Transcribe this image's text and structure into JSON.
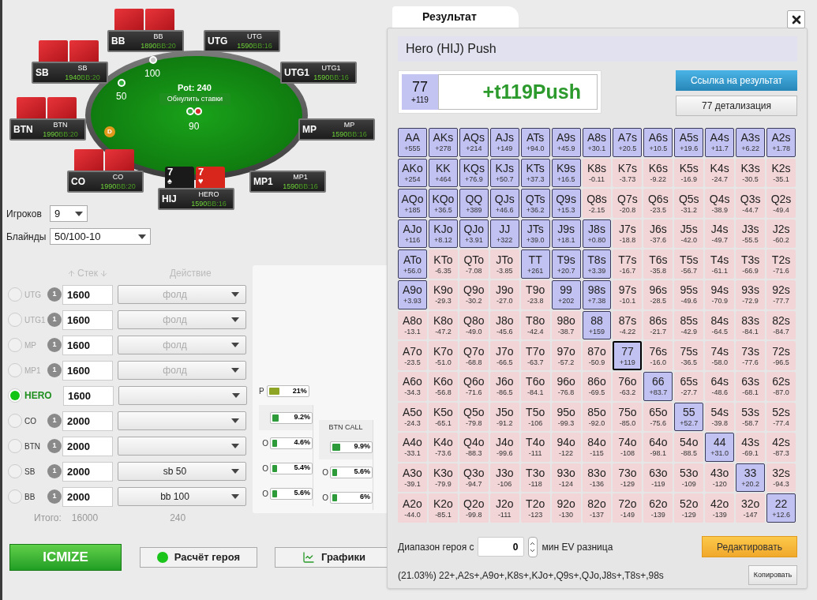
{
  "table": {
    "seats": [
      {
        "position": "BB",
        "name": "BB",
        "stack": "1890",
        "bb": "BB:20",
        "kind": "backs"
      },
      {
        "position": "UTG",
        "name": "UTG",
        "stack": "1590",
        "bb": "BB:16",
        "kind": "empty"
      },
      {
        "position": "SB",
        "name": "SB",
        "stack": "1940",
        "bb": "BB:20",
        "kind": "backs"
      },
      {
        "position": "UTG1",
        "name": "UTG1",
        "stack": "1590",
        "bb": "BB:16",
        "kind": "empty"
      },
      {
        "position": "BTN",
        "name": "BTN",
        "stack": "1990",
        "bb": "BB:20",
        "kind": "backs"
      },
      {
        "position": "MP",
        "name": "MP",
        "stack": "1590",
        "bb": "BB:16",
        "kind": "empty"
      },
      {
        "position": "CO",
        "name": "CO",
        "stack": "1990",
        "bb": "BB:20",
        "kind": "backs"
      },
      {
        "position": "HIJ",
        "name": "HERO",
        "stack": "1590",
        "bb": "BB:16",
        "kind": "open",
        "cards": [
          {
            "rank": "7",
            "suit": "♠",
            "red": false
          },
          {
            "rank": "7",
            "suit": "♥",
            "red": true
          }
        ]
      },
      {
        "position": "MP1",
        "name": "MP1",
        "stack": "1590",
        "bb": "BB:16",
        "kind": "empty"
      }
    ],
    "pot": "Pot: 240",
    "reset_button": "Обнулить ставки",
    "bets": [
      {
        "amount": "100",
        "chips": [
          {
            "color": "#c8c8c8"
          }
        ]
      },
      {
        "amount": "50",
        "chips": [
          {
            "color": "#2fae3a"
          }
        ]
      },
      {
        "amount": "90",
        "chips": [
          {
            "color": "#2fae3a"
          },
          {
            "color": "#d42a2a"
          }
        ]
      }
    ],
    "dealer": "D"
  },
  "controls": [
    {
      "label": "Игроков",
      "value": "9"
    },
    {
      "label": "Блайнды",
      "value": "50/100-10"
    }
  ],
  "players": {
    "stack_header": "Стек",
    "action_header": "Действие",
    "rows": [
      {
        "position": "UTG",
        "chips": "1",
        "stack": "1600",
        "action": "фолд",
        "folded": true,
        "selected": false
      },
      {
        "position": "UTG1",
        "chips": "1",
        "stack": "1600",
        "action": "фолд",
        "folded": true,
        "selected": false
      },
      {
        "position": "MP",
        "chips": "1",
        "stack": "1600",
        "action": "фолд",
        "folded": true,
        "selected": false
      },
      {
        "position": "MP1",
        "chips": "1",
        "stack": "1600",
        "action": "фолд",
        "folded": true,
        "selected": false
      },
      {
        "position": "HERO",
        "stack": "1600",
        "folded": false,
        "selected": true
      },
      {
        "position": "CO",
        "chips": "1",
        "stack": "2000",
        "folded": false,
        "selected": false
      },
      {
        "position": "BTN",
        "chips": "1",
        "stack": "2000",
        "folded": false,
        "selected": false
      },
      {
        "position": "SB",
        "chips": "1",
        "stack": "2000",
        "action": "sb 50",
        "folded": false,
        "selected": false
      },
      {
        "position": "BB",
        "chips": "1",
        "stack": "2000",
        "action": "bb 100",
        "folded": false,
        "selected": false
      }
    ],
    "total_label": "Итого:",
    "total_stack": "16000",
    "total_pot": "240"
  },
  "range_panel": {
    "push": {
      "label": "P",
      "level": 0.26,
      "value": "21%"
    },
    "columns": [
      {
        "rows": [
          {
            "level": 0.16,
            "value": "9.2%"
          },
          {
            "prefix": "O",
            "level": 0.12,
            "value": "4.6%"
          },
          {
            "prefix": "O",
            "level": 0.12,
            "value": "5.4%"
          },
          {
            "prefix": "O",
            "level": 0.12,
            "value": "5.6%"
          }
        ]
      },
      {
        "title": "BTN CALL",
        "rows": [
          {
            "level": 0.2,
            "value": "9.9%"
          },
          {
            "prefix": "O",
            "level": 0.12,
            "value": "5.6%"
          },
          {
            "prefix": "O",
            "level": 0.12,
            "value": "6%"
          }
        ]
      }
    ]
  },
  "buttons": [
    {
      "kind": "icmize",
      "label": "ICMIZE"
    },
    {
      "kind": "hero",
      "label": "Расчёт героя"
    },
    {
      "kind": "charts",
      "label": "Графики"
    }
  ],
  "result": {
    "tab": "Результат",
    "title": "Hero (HIJ) Push",
    "hand": "77",
    "hand_ev": "+119",
    "value": "+t119Push",
    "link_button": "Ссылка на результат",
    "detail_button": "77 детализация",
    "grid": [
      [
        {
          "hand": "AA",
          "ev": "+555",
          "in_range": true,
          "selected": false
        },
        {
          "hand": "AKs",
          "ev": "+278",
          "in_range": true,
          "selected": false
        },
        {
          "hand": "AQs",
          "ev": "+214",
          "in_range": true,
          "selected": false
        },
        {
          "hand": "AJs",
          "ev": "+149",
          "in_range": true,
          "selected": false
        },
        {
          "hand": "ATs",
          "ev": "+94.0",
          "in_range": true,
          "selected": false
        },
        {
          "hand": "A9s",
          "ev": "+45.9",
          "in_range": true,
          "selected": false
        },
        {
          "hand": "A8s",
          "ev": "+30.1",
          "in_range": true,
          "selected": false
        },
        {
          "hand": "A7s",
          "ev": "+20.5",
          "in_range": true,
          "selected": false
        },
        {
          "hand": "A6s",
          "ev": "+10.5",
          "in_range": true,
          "selected": false
        },
        {
          "hand": "A5s",
          "ev": "+19.6",
          "in_range": true,
          "selected": false
        },
        {
          "hand": "A4s",
          "ev": "+11.7",
          "in_range": true,
          "selected": false
        },
        {
          "hand": "A3s",
          "ev": "+6.22",
          "in_range": true,
          "selected": false
        },
        {
          "hand": "A2s",
          "ev": "+1.78",
          "in_range": true,
          "selected": false
        }
      ],
      [
        {
          "hand": "AKo",
          "ev": "+254",
          "in_range": true,
          "selected": false
        },
        {
          "hand": "KK",
          "ev": "+464",
          "in_range": true,
          "selected": false
        },
        {
          "hand": "KQs",
          "ev": "+76.9",
          "in_range": true,
          "selected": false
        },
        {
          "hand": "KJs",
          "ev": "+50.7",
          "in_range": true,
          "selected": false
        },
        {
          "hand": "KTs",
          "ev": "+37.3",
          "in_range": true,
          "selected": false
        },
        {
          "hand": "K9s",
          "ev": "+16.5",
          "in_range": true,
          "selected": false
        },
        {
          "hand": "K8s",
          "ev": "-0.11",
          "in_range": false,
          "selected": false
        },
        {
          "hand": "K7s",
          "ev": "-3.73",
          "in_range": false,
          "selected": false
        },
        {
          "hand": "K6s",
          "ev": "-9.22",
          "in_range": false,
          "selected": false
        },
        {
          "hand": "K5s",
          "ev": "-16.9",
          "in_range": false,
          "selected": false
        },
        {
          "hand": "K4s",
          "ev": "-24.7",
          "in_range": false,
          "selected": false
        },
        {
          "hand": "K3s",
          "ev": "-30.5",
          "in_range": false,
          "selected": false
        },
        {
          "hand": "K2s",
          "ev": "-35.1",
          "in_range": false,
          "selected": false
        }
      ],
      [
        {
          "hand": "AQo",
          "ev": "+185",
          "in_range": true,
          "selected": false
        },
        {
          "hand": "KQo",
          "ev": "+36.5",
          "in_range": true,
          "selected": false
        },
        {
          "hand": "QQ",
          "ev": "+389",
          "in_range": true,
          "selected": false
        },
        {
          "hand": "QJs",
          "ev": "+46.6",
          "in_range": true,
          "selected": false
        },
        {
          "hand": "QTs",
          "ev": "+36.2",
          "in_range": true,
          "selected": false
        },
        {
          "hand": "Q9s",
          "ev": "+15.3",
          "in_range": true,
          "selected": false
        },
        {
          "hand": "Q8s",
          "ev": "-2.15",
          "in_range": false,
          "selected": false
        },
        {
          "hand": "Q7s",
          "ev": "-20.8",
          "in_range": false,
          "selected": false
        },
        {
          "hand": "Q6s",
          "ev": "-23.5",
          "in_range": false,
          "selected": false
        },
        {
          "hand": "Q5s",
          "ev": "-31.2",
          "in_range": false,
          "selected": false
        },
        {
          "hand": "Q4s",
          "ev": "-38.9",
          "in_range": false,
          "selected": false
        },
        {
          "hand": "Q3s",
          "ev": "-44.7",
          "in_range": false,
          "selected": false
        },
        {
          "hand": "Q2s",
          "ev": "-49.4",
          "in_range": false,
          "selected": false
        }
      ],
      [
        {
          "hand": "AJo",
          "ev": "+116",
          "in_range": true,
          "selected": false
        },
        {
          "hand": "KJo",
          "ev": "+8.12",
          "in_range": true,
          "selected": false
        },
        {
          "hand": "QJo",
          "ev": "+3.91",
          "in_range": true,
          "selected": false
        },
        {
          "hand": "JJ",
          "ev": "+322",
          "in_range": true,
          "selected": false
        },
        {
          "hand": "JTs",
          "ev": "+39.0",
          "in_range": true,
          "selected": false
        },
        {
          "hand": "J9s",
          "ev": "+18.1",
          "in_range": true,
          "selected": false
        },
        {
          "hand": "J8s",
          "ev": "+0.80",
          "in_range": true,
          "selected": false
        },
        {
          "hand": "J7s",
          "ev": "-18.8",
          "in_range": false,
          "selected": false
        },
        {
          "hand": "J6s",
          "ev": "-37.6",
          "in_range": false,
          "selected": false
        },
        {
          "hand": "J5s",
          "ev": "-42.0",
          "in_range": false,
          "selected": false
        },
        {
          "hand": "J4s",
          "ev": "-49.7",
          "in_range": false,
          "selected": false
        },
        {
          "hand": "J3s",
          "ev": "-55.5",
          "in_range": false,
          "selected": false
        },
        {
          "hand": "J2s",
          "ev": "-60.2",
          "in_range": false,
          "selected": false
        }
      ],
      [
        {
          "hand": "ATo",
          "ev": "+56.0",
          "in_range": true,
          "selected": false
        },
        {
          "hand": "KTo",
          "ev": "-6.35",
          "in_range": false,
          "selected": false
        },
        {
          "hand": "QTo",
          "ev": "-7.08",
          "in_range": false,
          "selected": false
        },
        {
          "hand": "JTo",
          "ev": "-3.85",
          "in_range": false,
          "selected": false
        },
        {
          "hand": "TT",
          "ev": "+261",
          "in_range": true,
          "selected": false
        },
        {
          "hand": "T9s",
          "ev": "+20.7",
          "in_range": true,
          "selected": false
        },
        {
          "hand": "T8s",
          "ev": "+3.39",
          "in_range": true,
          "selected": false
        },
        {
          "hand": "T7s",
          "ev": "-16.7",
          "in_range": false,
          "selected": false
        },
        {
          "hand": "T6s",
          "ev": "-35.8",
          "in_range": false,
          "selected": false
        },
        {
          "hand": "T5s",
          "ev": "-56.7",
          "in_range": false,
          "selected": false
        },
        {
          "hand": "T4s",
          "ev": "-61.1",
          "in_range": false,
          "selected": false
        },
        {
          "hand": "T3s",
          "ev": "-66.9",
          "in_range": false,
          "selected": false
        },
        {
          "hand": "T2s",
          "ev": "-71.6",
          "in_range": false,
          "selected": false
        }
      ],
      [
        {
          "hand": "A9o",
          "ev": "+3.93",
          "in_range": true,
          "selected": false
        },
        {
          "hand": "K9o",
          "ev": "-29.3",
          "in_range": false,
          "selected": false
        },
        {
          "hand": "Q9o",
          "ev": "-30.2",
          "in_range": false,
          "selected": false
        },
        {
          "hand": "J9o",
          "ev": "-27.0",
          "in_range": false,
          "selected": false
        },
        {
          "hand": "T9o",
          "ev": "-23.8",
          "in_range": false,
          "selected": false
        },
        {
          "hand": "99",
          "ev": "+202",
          "in_range": true,
          "selected": false
        },
        {
          "hand": "98s",
          "ev": "+7.38",
          "in_range": true,
          "selected": false
        },
        {
          "hand": "97s",
          "ev": "-10.1",
          "in_range": false,
          "selected": false
        },
        {
          "hand": "96s",
          "ev": "-28.5",
          "in_range": false,
          "selected": false
        },
        {
          "hand": "95s",
          "ev": "-49.6",
          "in_range": false,
          "selected": false
        },
        {
          "hand": "94s",
          "ev": "-70.9",
          "in_range": false,
          "selected": false
        },
        {
          "hand": "93s",
          "ev": "-72.9",
          "in_range": false,
          "selected": false
        },
        {
          "hand": "92s",
          "ev": "-77.7",
          "in_range": false,
          "selected": false
        }
      ],
      [
        {
          "hand": "A8o",
          "ev": "-13.1",
          "in_range": false,
          "selected": false
        },
        {
          "hand": "K8o",
          "ev": "-47.2",
          "in_range": false,
          "selected": false
        },
        {
          "hand": "Q8o",
          "ev": "-49.0",
          "in_range": false,
          "selected": false
        },
        {
          "hand": "J8o",
          "ev": "-45.6",
          "in_range": false,
          "selected": false
        },
        {
          "hand": "T8o",
          "ev": "-42.4",
          "in_range": false,
          "selected": false
        },
        {
          "hand": "98o",
          "ev": "-38.7",
          "in_range": false,
          "selected": false
        },
        {
          "hand": "88",
          "ev": "+159",
          "in_range": true,
          "selected": false
        },
        {
          "hand": "87s",
          "ev": "-4.22",
          "in_range": false,
          "selected": false
        },
        {
          "hand": "86s",
          "ev": "-21.7",
          "in_range": false,
          "selected": false
        },
        {
          "hand": "85s",
          "ev": "-42.9",
          "in_range": false,
          "selected": false
        },
        {
          "hand": "84s",
          "ev": "-64.5",
          "in_range": false,
          "selected": false
        },
        {
          "hand": "83s",
          "ev": "-84.1",
          "in_range": false,
          "selected": false
        },
        {
          "hand": "82s",
          "ev": "-84.7",
          "in_range": false,
          "selected": false
        }
      ],
      [
        {
          "hand": "A7o",
          "ev": "-23.5",
          "in_range": false,
          "selected": false
        },
        {
          "hand": "K7o",
          "ev": "-51.0",
          "in_range": false,
          "selected": false
        },
        {
          "hand": "Q7o",
          "ev": "-68.8",
          "in_range": false,
          "selected": false
        },
        {
          "hand": "J7o",
          "ev": "-66.5",
          "in_range": false,
          "selected": false
        },
        {
          "hand": "T7o",
          "ev": "-63.7",
          "in_range": false,
          "selected": false
        },
        {
          "hand": "97o",
          "ev": "-57.2",
          "in_range": false,
          "selected": false
        },
        {
          "hand": "87o",
          "ev": "-50.9",
          "in_range": false,
          "selected": false
        },
        {
          "hand": "77",
          "ev": "+119",
          "in_range": true,
          "selected": true
        },
        {
          "hand": "76s",
          "ev": "-16.0",
          "in_range": false,
          "selected": false
        },
        {
          "hand": "75s",
          "ev": "-36.5",
          "in_range": false,
          "selected": false
        },
        {
          "hand": "74s",
          "ev": "-58.0",
          "in_range": false,
          "selected": false
        },
        {
          "hand": "73s",
          "ev": "-77.6",
          "in_range": false,
          "selected": false
        },
        {
          "hand": "72s",
          "ev": "-96.5",
          "in_range": false,
          "selected": false
        }
      ],
      [
        {
          "hand": "A6o",
          "ev": "-34.3",
          "in_range": false,
          "selected": false
        },
        {
          "hand": "K6o",
          "ev": "-56.8",
          "in_range": false,
          "selected": false
        },
        {
          "hand": "Q6o",
          "ev": "-71.6",
          "in_range": false,
          "selected": false
        },
        {
          "hand": "J6o",
          "ev": "-86.5",
          "in_range": false,
          "selected": false
        },
        {
          "hand": "T6o",
          "ev": "-84.1",
          "in_range": false,
          "selected": false
        },
        {
          "hand": "96o",
          "ev": "-76.8",
          "in_range": false,
          "selected": false
        },
        {
          "hand": "86o",
          "ev": "-69.5",
          "in_range": false,
          "selected": false
        },
        {
          "hand": "76o",
          "ev": "-63.2",
          "in_range": false,
          "selected": false
        },
        {
          "hand": "66",
          "ev": "+83.7",
          "in_range": true,
          "selected": false
        },
        {
          "hand": "65s",
          "ev": "-27.7",
          "in_range": false,
          "selected": false
        },
        {
          "hand": "64s",
          "ev": "-48.6",
          "in_range": false,
          "selected": false
        },
        {
          "hand": "63s",
          "ev": "-68.1",
          "in_range": false,
          "selected": false
        },
        {
          "hand": "62s",
          "ev": "-87.0",
          "in_range": false,
          "selected": false
        }
      ],
      [
        {
          "hand": "A5o",
          "ev": "-24.3",
          "in_range": false,
          "selected": false
        },
        {
          "hand": "K5o",
          "ev": "-65.1",
          "in_range": false,
          "selected": false
        },
        {
          "hand": "Q5o",
          "ev": "-79.8",
          "in_range": false,
          "selected": false
        },
        {
          "hand": "J5o",
          "ev": "-91.2",
          "in_range": false,
          "selected": false
        },
        {
          "hand": "T5o",
          "ev": "-106",
          "in_range": false,
          "selected": false
        },
        {
          "hand": "95o",
          "ev": "-99.3",
          "in_range": false,
          "selected": false
        },
        {
          "hand": "85o",
          "ev": "-92.0",
          "in_range": false,
          "selected": false
        },
        {
          "hand": "75o",
          "ev": "-85.0",
          "in_range": false,
          "selected": false
        },
        {
          "hand": "65o",
          "ev": "-75.6",
          "in_range": false,
          "selected": false
        },
        {
          "hand": "55",
          "ev": "+52.7",
          "in_range": true,
          "selected": false
        },
        {
          "hand": "54s",
          "ev": "-39.8",
          "in_range": false,
          "selected": false
        },
        {
          "hand": "53s",
          "ev": "-58.7",
          "in_range": false,
          "selected": false
        },
        {
          "hand": "52s",
          "ev": "-77.4",
          "in_range": false,
          "selected": false
        }
      ],
      [
        {
          "hand": "A4o",
          "ev": "-33.1",
          "in_range": false,
          "selected": false
        },
        {
          "hand": "K4o",
          "ev": "-73.6",
          "in_range": false,
          "selected": false
        },
        {
          "hand": "Q4o",
          "ev": "-88.3",
          "in_range": false,
          "selected": false
        },
        {
          "hand": "J4o",
          "ev": "-99.6",
          "in_range": false,
          "selected": false
        },
        {
          "hand": "T4o",
          "ev": "-111",
          "in_range": false,
          "selected": false
        },
        {
          "hand": "94o",
          "ev": "-122",
          "in_range": false,
          "selected": false
        },
        {
          "hand": "84o",
          "ev": "-115",
          "in_range": false,
          "selected": false
        },
        {
          "hand": "74o",
          "ev": "-108",
          "in_range": false,
          "selected": false
        },
        {
          "hand": "64o",
          "ev": "-98.1",
          "in_range": false,
          "selected": false
        },
        {
          "hand": "54o",
          "ev": "-88.5",
          "in_range": false,
          "selected": false
        },
        {
          "hand": "44",
          "ev": "+31.0",
          "in_range": true,
          "selected": false
        },
        {
          "hand": "43s",
          "ev": "-69.1",
          "in_range": false,
          "selected": false
        },
        {
          "hand": "42s",
          "ev": "-87.3",
          "in_range": false,
          "selected": false
        }
      ],
      [
        {
          "hand": "A3o",
          "ev": "-39.1",
          "in_range": false,
          "selected": false
        },
        {
          "hand": "K3o",
          "ev": "-79.9",
          "in_range": false,
          "selected": false
        },
        {
          "hand": "Q3o",
          "ev": "-94.7",
          "in_range": false,
          "selected": false
        },
        {
          "hand": "J3o",
          "ev": "-106",
          "in_range": false,
          "selected": false
        },
        {
          "hand": "T3o",
          "ev": "-118",
          "in_range": false,
          "selected": false
        },
        {
          "hand": "93o",
          "ev": "-124",
          "in_range": false,
          "selected": false
        },
        {
          "hand": "83o",
          "ev": "-136",
          "in_range": false,
          "selected": false
        },
        {
          "hand": "73o",
          "ev": "-129",
          "in_range": false,
          "selected": false
        },
        {
          "hand": "63o",
          "ev": "-119",
          "in_range": false,
          "selected": false
        },
        {
          "hand": "53o",
          "ev": "-109",
          "in_range": false,
          "selected": false
        },
        {
          "hand": "43o",
          "ev": "-120",
          "in_range": false,
          "selected": false
        },
        {
          "hand": "33",
          "ev": "+20.2",
          "in_range": true,
          "selected": false
        },
        {
          "hand": "32s",
          "ev": "-94.3",
          "in_range": false,
          "selected": false
        }
      ],
      [
        {
          "hand": "A2o",
          "ev": "-44.0",
          "in_range": false,
          "selected": false
        },
        {
          "hand": "K2o",
          "ev": "-85.1",
          "in_range": false,
          "selected": false
        },
        {
          "hand": "Q2o",
          "ev": "-99.8",
          "in_range": false,
          "selected": false
        },
        {
          "hand": "J2o",
          "ev": "-111",
          "in_range": false,
          "selected": false
        },
        {
          "hand": "T2o",
          "ev": "-123",
          "in_range": false,
          "selected": false
        },
        {
          "hand": "92o",
          "ev": "-130",
          "in_range": false,
          "selected": false
        },
        {
          "hand": "82o",
          "ev": "-137",
          "in_range": false,
          "selected": false
        },
        {
          "hand": "72o",
          "ev": "-149",
          "in_range": false,
          "selected": false
        },
        {
          "hand": "62o",
          "ev": "-139",
          "in_range": false,
          "selected": false
        },
        {
          "hand": "52o",
          "ev": "-129",
          "in_range": false,
          "selected": false
        },
        {
          "hand": "42o",
          "ev": "-139",
          "in_range": false,
          "selected": false
        },
        {
          "hand": "32o",
          "ev": "-147",
          "in_range": false,
          "selected": false
        },
        {
          "hand": "22",
          "ev": "+12.6",
          "in_range": true,
          "selected": false
        }
      ]
    ],
    "filter_label": "Диапазон героя с",
    "filter_value": "0",
    "filter_suffix": "мин EV разница",
    "edit_button": "Редактировать",
    "range_text": "(21.03%) 22+,A2s+,A9o+,K8s+,KJo+,Q9s+,QJo,J8s+,T8s+,98s",
    "copy_button": "Копировать"
  }
}
